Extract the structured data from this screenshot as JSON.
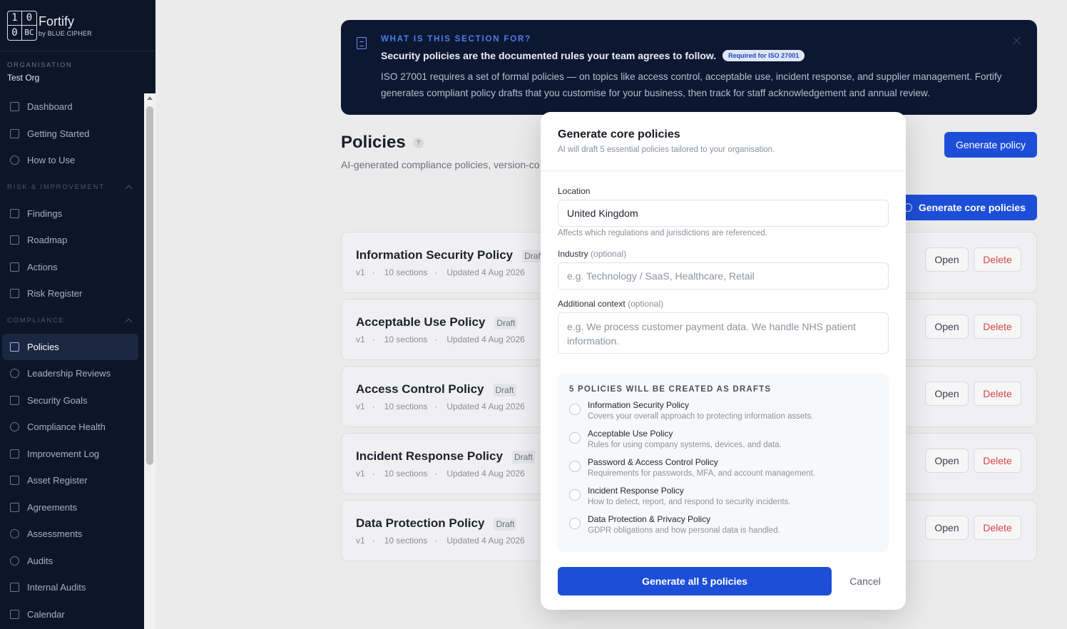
{
  "app": {
    "logo_digits": [
      "1",
      "0",
      "0",
      "BC"
    ],
    "name": "Fortify",
    "byline": "by BLUE CIPHER"
  },
  "organisation": {
    "label": "ORGANISATION",
    "name": "Test Org"
  },
  "sidebar": {
    "top_items": [
      {
        "label": "Dashboard",
        "icon": "home-icon"
      },
      {
        "label": "Getting Started",
        "icon": "clipboard-icon"
      },
      {
        "label": "How to Use",
        "icon": "help-circle-icon"
      }
    ],
    "risk_section": "RISK & IMPROVEMENT",
    "risk_items": [
      {
        "label": "Findings",
        "icon": "clipboard-icon"
      },
      {
        "label": "Roadmap",
        "icon": "map-icon"
      },
      {
        "label": "Actions",
        "icon": "clipboard-list-icon"
      },
      {
        "label": "Risk Register",
        "icon": "file-icon"
      }
    ],
    "compliance_section": "COMPLIANCE",
    "compliance_items": [
      {
        "label": "Policies",
        "icon": "document-icon",
        "active": true
      },
      {
        "label": "Leadership Reviews",
        "icon": "users-icon"
      },
      {
        "label": "Security Goals",
        "icon": "bar-chart-icon"
      },
      {
        "label": "Compliance Health",
        "icon": "heart-icon"
      },
      {
        "label": "Improvement Log",
        "icon": "edit-icon"
      },
      {
        "label": "Asset Register",
        "icon": "database-icon"
      },
      {
        "label": "Agreements",
        "icon": "document-icon"
      },
      {
        "label": "Assessments",
        "icon": "shield-icon"
      },
      {
        "label": "Audits",
        "icon": "check-circle-icon"
      },
      {
        "label": "Internal Audits",
        "icon": "calendar-check-icon"
      },
      {
        "label": "Calendar",
        "icon": "calendar-icon"
      }
    ]
  },
  "banner": {
    "kicker": "WHAT IS THIS SECTION FOR?",
    "title": "Security policies are the documented rules your team agrees to follow.",
    "badge": "Required for ISO 27001",
    "body": "ISO 27001 requires a set of formal policies — on topics like access control, acceptable use, incident response, and supplier management. Fortify generates compliant policy drafts that you customise for your business, then track for staff acknowledgement and annual review."
  },
  "page": {
    "title": "Policies",
    "help": "?",
    "subtitle": "AI-generated compliance policies, version-co",
    "generate_policy": "Generate policy",
    "generate_core": "Generate core policies"
  },
  "policies": [
    {
      "title": "Information Security Policy",
      "status": "Draft",
      "version": "v1",
      "sections": "10 sections",
      "updated": "Updated 4 Aug 2026"
    },
    {
      "title": "Acceptable Use Policy",
      "status": "Draft",
      "version": "v1",
      "sections": "10 sections",
      "updated": "Updated 4 Aug 2026"
    },
    {
      "title": "Access Control Policy",
      "status": "Draft",
      "version": "v1",
      "sections": "10 sections",
      "updated": "Updated 4 Aug 2026"
    },
    {
      "title": "Incident Response Policy",
      "status": "Draft",
      "version": "v1",
      "sections": "10 sections",
      "updated": "Updated 4 Aug 2026"
    },
    {
      "title": "Data Protection Policy",
      "status": "Draft",
      "version": "v1",
      "sections": "10 sections",
      "updated": "Updated 4 Aug 2026"
    }
  ],
  "row_actions": {
    "open": "Open",
    "delete": "Delete",
    "sep": "·"
  },
  "modal": {
    "title": "Generate core policies",
    "subtitle": "AI will draft 5 essential policies tailored to your organisation.",
    "location_label": "Location",
    "location_value": "United Kingdom",
    "location_help": "Affects which regulations and jurisdictions are referenced.",
    "industry_label": "Industry",
    "industry_optional": "(optional)",
    "industry_placeholder": "e.g. Technology / SaaS, Healthcare, Retail",
    "context_label": "Additional context",
    "context_optional": "(optional)",
    "context_placeholder": "e.g. We process customer payment data. We handle NHS patient information.",
    "drafts_title": "5 POLICIES WILL BE CREATED AS DRAFTS",
    "drafts": [
      {
        "name": "Information Security Policy",
        "desc": "Covers your overall approach to protecting information assets."
      },
      {
        "name": "Acceptable Use Policy",
        "desc": "Rules for using company systems, devices, and data."
      },
      {
        "name": "Password & Access Control Policy",
        "desc": "Requirements for passwords, MFA, and account management."
      },
      {
        "name": "Incident Response Policy",
        "desc": "How to detect, report, and respond to security incidents."
      },
      {
        "name": "Data Protection & Privacy Policy",
        "desc": "GDPR obligations and how personal data is handled."
      }
    ],
    "submit": "Generate all 5 policies",
    "cancel": "Cancel"
  },
  "colors": {
    "primary": "#1d4ed8",
    "sidebar_bg": "#0d1628",
    "banner_bg": "#0c1832",
    "danger": "#d64545"
  }
}
